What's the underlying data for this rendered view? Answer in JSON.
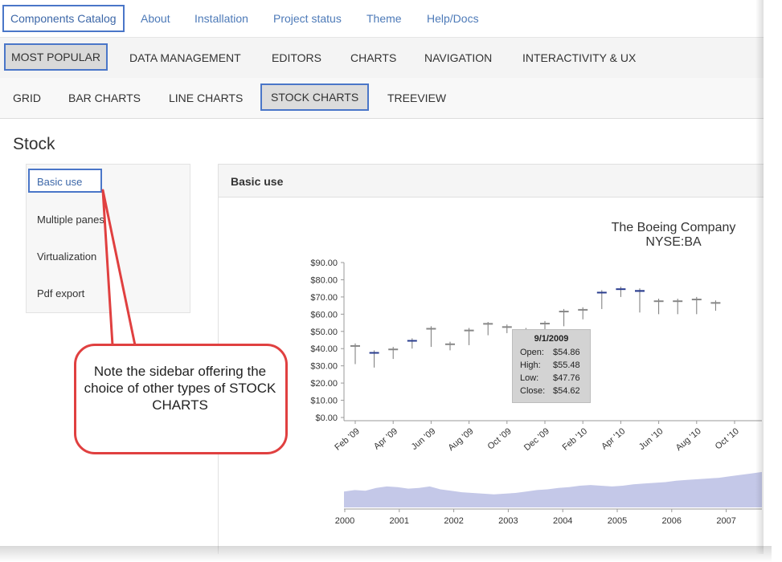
{
  "topnav": {
    "brand": "Components Catalog",
    "items": [
      "About",
      "Installation",
      "Project status",
      "Theme",
      "Help/Docs"
    ]
  },
  "nav2": {
    "active": "MOST POPULAR",
    "items": [
      "DATA MANAGEMENT",
      "EDITORS",
      "CHARTS",
      "NAVIGATION",
      "INTERACTIVITY & UX"
    ]
  },
  "nav3": {
    "items": [
      "GRID",
      "BAR CHARTS",
      "LINE CHARTS",
      "STOCK CHARTS",
      "TREEVIEW"
    ],
    "active": "STOCK CHARTS"
  },
  "page_title": "Stock",
  "sidebar": {
    "active": "Basic use",
    "items": [
      "Multiple panes",
      "Virtualization",
      "Pdf export"
    ]
  },
  "panel": {
    "title": "Basic use"
  },
  "tooltip": {
    "date": "9/1/2009",
    "rows": [
      {
        "label": "Open:",
        "value": "$54.86"
      },
      {
        "label": "High:",
        "value": "$55.48"
      },
      {
        "label": "Low:",
        "value": "$47.76"
      },
      {
        "label": "Close:",
        "value": "$54.62"
      }
    ]
  },
  "callout": {
    "text": "Note the sidebar offering the choice of other types of STOCK CHARTS"
  },
  "colors": {
    "accent": "#4a76c8",
    "link": "#4d7ab8",
    "callout_border": "#e04040",
    "candle_up": "#888888",
    "candle_down": "#2a3d8f",
    "navigator_fill": "#c4c8e8"
  },
  "chart_data": {
    "type": "candlestick",
    "title": "The Boeing Company",
    "subtitle": "NYSE:BA",
    "ylim": [
      0,
      90
    ],
    "y_ticks": [
      "$0.00",
      "$10.00",
      "$20.00",
      "$30.00",
      "$40.00",
      "$50.00",
      "$60.00",
      "$70.00",
      "$80.00",
      "$90.00"
    ],
    "x_ticks": [
      "Feb '09",
      "Apr '09",
      "Jun '09",
      "Aug '09",
      "Oct '09",
      "Dec '09",
      "Feb '10",
      "Apr '10",
      "Jun '10",
      "Aug '10",
      "Oct '10"
    ],
    "candles": [
      {
        "date": "Jan '09",
        "open": 42,
        "high": 43,
        "low": 31,
        "close": 42
      },
      {
        "date": "Feb '09",
        "open": 38,
        "high": 39,
        "low": 29,
        "close": 38
      },
      {
        "date": "Mar '09",
        "open": 40,
        "high": 41,
        "low": 34,
        "close": 40
      },
      {
        "date": "Apr '09",
        "open": 45,
        "high": 46,
        "low": 40,
        "close": 45
      },
      {
        "date": "May '09",
        "open": 52,
        "high": 53,
        "low": 41,
        "close": 52
      },
      {
        "date": "Jun '09",
        "open": 43,
        "high": 44,
        "low": 39,
        "close": 43
      },
      {
        "date": "Jul '09",
        "open": 51,
        "high": 52,
        "low": 42,
        "close": 51
      },
      {
        "date": "Aug '09",
        "open": 54.86,
        "high": 55.48,
        "low": 47.76,
        "close": 54.62
      },
      {
        "date": "Sep '09",
        "open": 53,
        "high": 54,
        "low": 49,
        "close": 53
      },
      {
        "date": "Oct '09",
        "open": 51,
        "high": 52,
        "low": 47,
        "close": 51
      },
      {
        "date": "Nov '09",
        "open": 55,
        "high": 56,
        "low": 48,
        "close": 55
      },
      {
        "date": "Dec '09",
        "open": 62,
        "high": 63,
        "low": 53,
        "close": 62
      },
      {
        "date": "Jan '10",
        "open": 63,
        "high": 64,
        "low": 57,
        "close": 63
      },
      {
        "date": "Feb '10",
        "open": 73,
        "high": 74,
        "low": 63,
        "close": 73
      },
      {
        "date": "Mar '10",
        "open": 75,
        "high": 76,
        "low": 70,
        "close": 75
      },
      {
        "date": "Apr '10",
        "open": 74,
        "high": 75,
        "low": 61,
        "close": 73
      },
      {
        "date": "May '10",
        "open": 68,
        "high": 69,
        "low": 60,
        "close": 68
      },
      {
        "date": "Jun '10",
        "open": 68,
        "high": 69,
        "low": 60,
        "close": 68
      },
      {
        "date": "Jul '10",
        "open": 69,
        "high": 70,
        "low": 60,
        "close": 69
      },
      {
        "date": "Aug '10",
        "open": 67,
        "high": 68,
        "low": 62,
        "close": 67
      }
    ],
    "navigator": {
      "type": "area",
      "x_ticks": [
        "2000",
        "2001",
        "2002",
        "2003",
        "2004",
        "2005",
        "2006",
        "2007"
      ],
      "values": [
        22,
        24,
        23,
        27,
        29,
        28,
        26,
        27,
        29,
        25,
        23,
        21,
        20,
        19,
        18,
        19,
        20,
        22,
        24,
        25,
        27,
        28,
        30,
        31,
        30,
        29,
        30,
        32,
        33,
        34,
        35,
        37,
        38,
        39,
        40,
        41,
        43,
        45,
        47,
        49
      ]
    }
  }
}
